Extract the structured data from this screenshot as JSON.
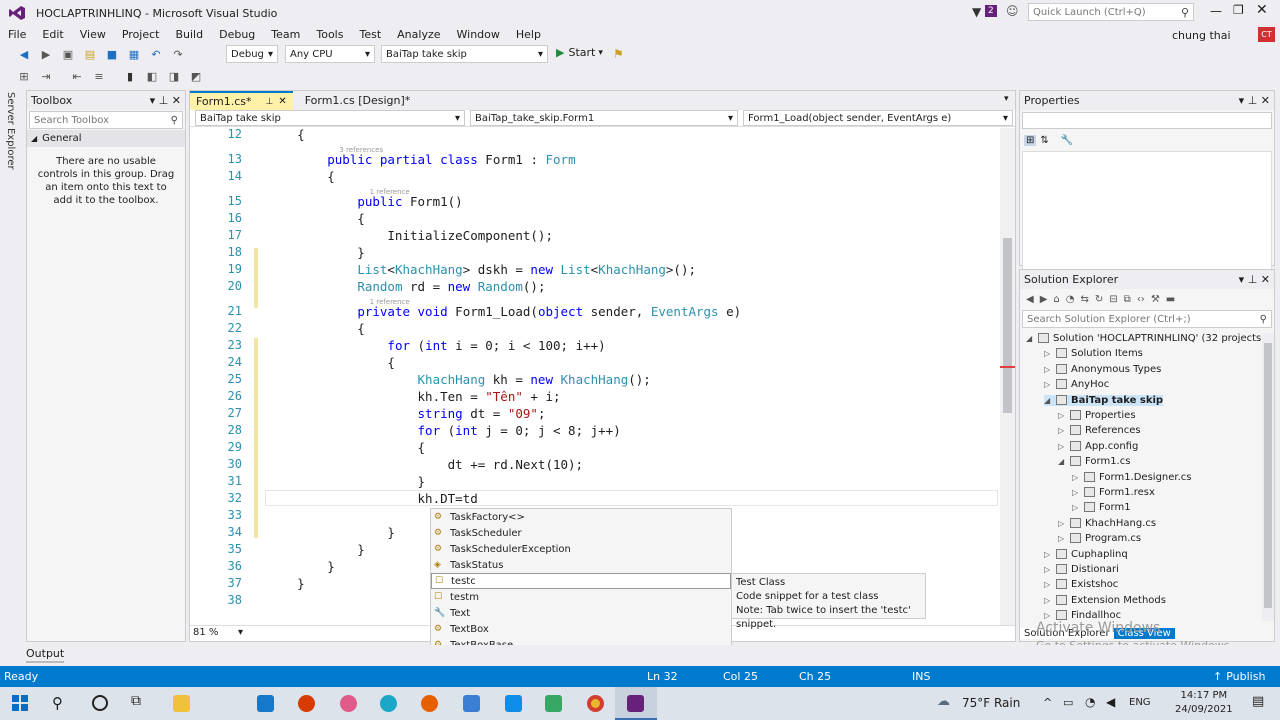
{
  "window": {
    "title": "HOCLAPTRINHLINQ - Microsoft Visual Studio",
    "notif_count": "2",
    "quick_launch": "Quick Launch (Ctrl+Q)",
    "user": "chung thai",
    "user_initials": "CT"
  },
  "menu": [
    "File",
    "Edit",
    "View",
    "Project",
    "Build",
    "Debug",
    "Team",
    "Tools",
    "Test",
    "Analyze",
    "Window",
    "Help"
  ],
  "toolbar": {
    "config": "Debug",
    "platform": "Any CPU",
    "project": "BaiTap take skip",
    "start": "Start"
  },
  "left_strip": "Server Explorer",
  "toolbox": {
    "title": "Toolbox",
    "search": "Search Toolbox",
    "group": "General",
    "empty_text": "There are no usable controls in this group. Drag an item onto this text to add it to the toolbox."
  },
  "editor": {
    "tabs": [
      {
        "label": "Form1.cs*"
      },
      {
        "label": "Form1.cs [Design]*"
      }
    ],
    "nav": {
      "project": "BaiTap take skip",
      "class": "BaiTap_take_skip.Form1",
      "member": "Form1_Load(object sender, EventArgs e)"
    },
    "zoom": "81 %",
    "lines": [
      {
        "n": "12",
        "code": "    {"
      },
      {
        "n": "13",
        "code": "        public partial class Form1 : Form",
        "ref": "3 references"
      },
      {
        "n": "14",
        "code": "        {"
      },
      {
        "n": "15",
        "code": "            public Form1()",
        "ref": "1 reference"
      },
      {
        "n": "16",
        "code": "            {"
      },
      {
        "n": "17",
        "code": "                InitializeComponent();"
      },
      {
        "n": "18",
        "code": "            }"
      },
      {
        "n": "19",
        "code": "            List<KhachHang> dskh = new List<KhachHang>();"
      },
      {
        "n": "20",
        "code": "            Random rd = new Random();"
      },
      {
        "n": "21",
        "code": "            private void Form1_Load(object sender, EventArgs e)",
        "ref": "1 reference"
      },
      {
        "n": "22",
        "code": "            {"
      },
      {
        "n": "23",
        "code": "                for (int i = 0; i < 100; i++)"
      },
      {
        "n": "24",
        "code": "                {"
      },
      {
        "n": "25",
        "code": "                    KhachHang kh = new KhachHang();"
      },
      {
        "n": "26",
        "code": "                    kh.Ten = \"Tên\" + i;"
      },
      {
        "n": "27",
        "code": "                    string dt = \"09\";"
      },
      {
        "n": "28",
        "code": "                    for (int j = 0; j < 8; j++)"
      },
      {
        "n": "29",
        "code": "                    {"
      },
      {
        "n": "30",
        "code": "                        dt += rd.Next(10);"
      },
      {
        "n": "31",
        "code": "                    }"
      },
      {
        "n": "32",
        "code": "                    kh.DT=td"
      },
      {
        "n": "33",
        "code": ""
      },
      {
        "n": "34",
        "code": "                }"
      },
      {
        "n": "35",
        "code": "            }"
      },
      {
        "n": "36",
        "code": "        }"
      },
      {
        "n": "37",
        "code": "    }"
      },
      {
        "n": "38",
        "code": ""
      }
    ]
  },
  "intellisense": {
    "items": [
      "TaskFactory<>",
      "TaskScheduler",
      "TaskSchedulerException",
      "TaskStatus",
      "testc",
      "testm",
      "Text",
      "TextBox",
      "TextBoxBase"
    ],
    "selected": "testc",
    "tooltip": [
      "Test Class",
      "Code snippet for a test class",
      "Note: Tab twice to insert the 'testc' snippet."
    ]
  },
  "properties": {
    "title": "Properties"
  },
  "solution": {
    "title": "Solution Explorer",
    "search": "Search Solution Explorer (Ctrl+;)",
    "items": [
      "Solution 'HOCLAPTRINHLINQ' (32 projects)",
      "Solution Items",
      "Anonymous Types",
      "AnyHoc",
      "BaiTap take skip",
      "Properties",
      "References",
      "App.config",
      "Form1.cs",
      "Form1.Designer.cs",
      "Form1.resx",
      "Form1",
      "KhachHang.cs",
      "Program.cs",
      "Cuphaplinq",
      "Distionari",
      "Existshoc",
      "Extension Methods",
      "Findallhoc"
    ],
    "bottom_tabs": [
      "Solution Explorer",
      "Class View"
    ]
  },
  "watermark": {
    "line1": "Activate Windows",
    "line2": "Go to Settings to activate Windows."
  },
  "output_tab": "Output",
  "status": {
    "ready": "Ready",
    "ln": "Ln 32",
    "col": "Col 25",
    "ch": "Ch 25",
    "mode": "INS",
    "publish": "Publish"
  },
  "taskbar": {
    "weather": "75°F  Rain",
    "lang": "ENG",
    "time": "14:17 PM",
    "date": "24/09/2021"
  }
}
